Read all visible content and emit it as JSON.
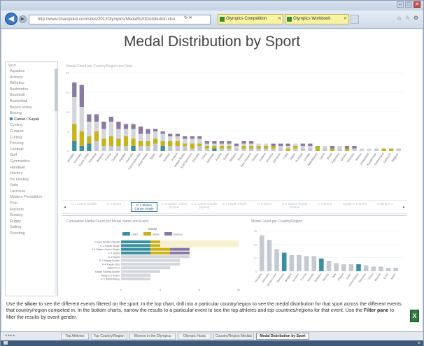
{
  "browser": {
    "url": "http://www.sharepoint.com/sites/2012Olympics/Medal%20Distribution.xlsx",
    "tabs": [
      {
        "label": "Olympics Competition"
      },
      {
        "label": "Olympics Workbook"
      }
    ]
  },
  "page": {
    "title": "Medal Distribution by Sport"
  },
  "slicer": {
    "header": "Sport",
    "items": [
      "Aquatics",
      "Archery",
      "Athletics",
      "Badminton",
      "Baseball",
      "Basketball",
      "Beach Volley",
      "Boxing",
      "Canoe / Kayak",
      "Cycling",
      "Croquet",
      "Curling",
      "Fencing",
      "Football",
      "Golf",
      "Gymnastics",
      "Handball",
      "Hockey",
      "Ice Hockey",
      "Judo",
      "Lacrosse",
      "Modern Pentathlon",
      "Polo",
      "Rackets",
      "Rowing",
      "Rugby",
      "Sailing",
      "Shooting"
    ],
    "selected_index": 8
  },
  "top_chart": {
    "title": "Medal Count per Country/Region and Year"
  },
  "timeline": {
    "items": [
      "C-1 Canoe Double",
      "C-1 Sprint",
      "C-1 Slalom Canoe Single",
      "C-2 Slalom Canoe Double",
      "C-2 Canoe Double (Sprint)",
      "K-1 Kayak Single",
      "K-1 Sprint",
      "K-2 Slalom Kayak Double",
      "K-4 Sprint",
      "Kayak K-1 Sprint",
      "Folding K-1"
    ],
    "active_index": 2
  },
  "bottom_left": {
    "title": "Cumulative Medal Count per Medal Name and Event"
  },
  "bottom_right": {
    "title": "Medal Count per Country/Region"
  },
  "instructions": {
    "p1": "Use the ",
    "b1": "slicer",
    "p2": " to see the different events filtered on the sport. In the top chart, drill into a particular country/region to see the medal distribution for that sport across the different events that country/region competed in. In the bottom charts, narrow the results to a particular event to see the top athletes and top countries/regions for that event. Use the ",
    "b2": "Filter pane",
    "p3": " to filter the results by event gender."
  },
  "sheets": {
    "nav": "◂ ◂ ▸ ▸",
    "tabs": [
      "Top Athletes",
      "Top Country/Region",
      "Women in the Olympics",
      "Olympic Hosts",
      "Country/Region Medals",
      "Medal Distribution by Sport"
    ],
    "active_index": 5
  },
  "colors": {
    "gold": "#c9b21a",
    "silver": "#c4c9d2",
    "bronze": "#8a7aa3",
    "teal": "#3a8fa0",
    "grey": "#d3d6db",
    "accent_green": "#9bbb3c"
  },
  "chart_data": [
    {
      "type": "bar",
      "title": "Medal Count per Country/Region and Year",
      "stacked": true,
      "categories": [
        "Hungary",
        "Germany",
        "Soviet Union",
        "Romania",
        "Bulgaria",
        "France",
        "Canada",
        "Sweden",
        "Australia",
        "Czechoslovakia",
        "Great Britain",
        "Spain",
        "Italy",
        "Norway",
        "Poland",
        "United States",
        "East Germany",
        "Slovakia",
        "China",
        "Denmark",
        "Austria",
        "Serbia",
        "Belarus",
        "Russia",
        "New Zealand",
        "Ukraine",
        "Finland",
        "Slovenia",
        "Lithuania",
        "Cuba",
        "Japan",
        "Portugal",
        "Croatia",
        "Netherlands",
        "Latvia",
        "Brazil",
        "Argentina",
        "Greece",
        "Moldova",
        "Mexico",
        "Uzbekistan",
        "Kazakhstan",
        "Switzerland",
        "Latvia (2)",
        "Belgium"
      ],
      "series": [
        {
          "values": [
            4,
            2,
            3,
            4,
            2,
            2,
            2,
            2,
            2,
            2,
            2,
            3,
            2,
            2,
            2,
            2,
            1,
            2,
            1,
            1,
            1,
            1,
            1,
            1,
            1,
            1,
            1,
            1,
            1,
            0,
            1,
            1,
            1,
            0,
            1,
            0,
            1,
            0,
            1,
            0,
            0,
            1,
            0,
            0,
            1
          ]
        },
        {
          "values": [
            7,
            6,
            3,
            4,
            3,
            4,
            3,
            4,
            3,
            2,
            2,
            2,
            2,
            2,
            2,
            1,
            2,
            1,
            1,
            1,
            1,
            1,
            0,
            1,
            1,
            1,
            1,
            1,
            0,
            1,
            1,
            0,
            0,
            1,
            0,
            1,
            0,
            1,
            0,
            0,
            0,
            0,
            1,
            1,
            0
          ]
        },
        {
          "values": [
            11,
            10,
            6,
            4,
            4,
            6,
            4,
            3,
            4,
            3,
            3,
            3,
            3,
            2,
            2,
            2,
            2,
            2,
            1,
            1,
            1,
            1,
            1,
            1,
            1,
            1,
            1,
            0,
            1,
            1,
            1,
            1,
            1,
            1,
            1,
            0,
            1,
            0,
            0,
            1,
            1,
            0,
            0,
            0,
            0
          ]
        },
        {
          "values": [
            6,
            9,
            3,
            3,
            3,
            2,
            3,
            2,
            2,
            3,
            2,
            1,
            1,
            1,
            1,
            1,
            1,
            1,
            1,
            1,
            1,
            1,
            1,
            1,
            1,
            0,
            0,
            1,
            1,
            1,
            0,
            1,
            1,
            0,
            0,
            1,
            0,
            1,
            1,
            0,
            0,
            0,
            0,
            0,
            0
          ]
        }
      ],
      "ylim": [
        0,
        32
      ]
    },
    {
      "type": "bar",
      "orientation": "horizontal",
      "title": "Cumulative Medal Count per Medal Name and Event",
      "legend": [
        "Gold",
        "Silver",
        "Bronze"
      ],
      "legend_title": "Medal",
      "categories": [
        "Canoe Double (Sprint)",
        "K-1 Kayak Single",
        "K-1 Slalom Canoe Single",
        "C-1 Sprint",
        "C-2 Sprint",
        "K-2 Kayak Double",
        "K-4 Kayak Four",
        "Slalom K-1",
        "Kayak Folding Double",
        "Relay K-1 4x500",
        "K-1 4x500 Relay"
      ],
      "series": [
        {
          "name": "Gold",
          "values": [
            3,
            3,
            3,
            3,
            3,
            2,
            2,
            2,
            2,
            1,
            1
          ]
        },
        {
          "name": "Silver",
          "values": [
            2,
            2,
            2,
            2,
            2,
            2,
            2,
            2,
            1,
            1,
            1
          ]
        },
        {
          "name": "Bronze",
          "values": [
            4,
            2,
            2,
            2,
            2,
            2,
            2,
            1,
            1,
            1,
            1
          ]
        }
      ],
      "xlim": [
        0,
        12
      ]
    },
    {
      "type": "bar",
      "title": "Medal Count per Country/Region",
      "categories": [
        "Hungary",
        "Germany",
        "Soviet Union",
        "Romania",
        "Bulgaria",
        "Sweden",
        "France",
        "Canada",
        "Australia",
        "Norway",
        "Italy",
        "Poland",
        "Spain",
        "United States",
        "Denmark",
        "China",
        "Belarus",
        "Cuba",
        "Japan"
      ],
      "values": [
        31,
        27,
        19,
        16,
        14,
        14,
        13,
        13,
        11,
        9,
        7,
        6,
        6,
        6,
        5,
        4,
        4,
        3,
        3
      ],
      "highlight": [
        3,
        8,
        13
      ],
      "ylim": [
        0,
        35
      ]
    }
  ]
}
